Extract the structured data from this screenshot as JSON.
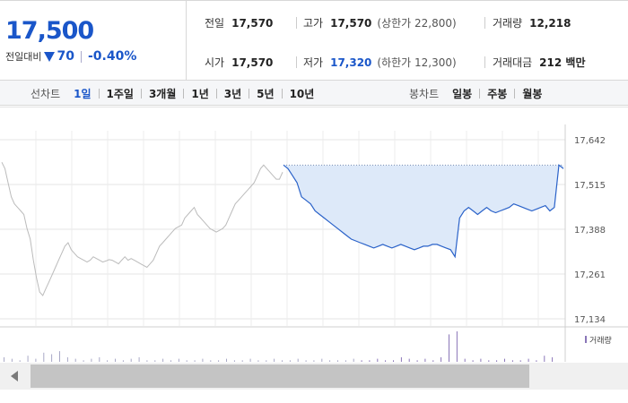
{
  "price": {
    "current": "17,500",
    "change_label": "전일대비",
    "change_amount": "70",
    "change_percent": "-0.40%",
    "direction_icon": "down-triangle-icon",
    "color": "#1a56c9"
  },
  "stats": {
    "prev_close_label": "전일",
    "prev_close": "17,570",
    "high_label": "고가",
    "high": "17,570",
    "upper_limit": "(상한가 22,800)",
    "volume_label": "거래량",
    "volume": "12,218",
    "open_label": "시가",
    "open": "17,570",
    "low_label": "저가",
    "low": "17,320",
    "lower_limit": "(하한가 12,300)",
    "amount_label": "거래대금",
    "amount": "212 백만"
  },
  "toolbar": {
    "line_chart_label": "선차트",
    "line_periods": [
      "1일",
      "1주일",
      "3개월",
      "1년",
      "3년",
      "5년",
      "10년"
    ],
    "active_line_period": "1일",
    "candle_chart_label": "봉차트",
    "candle_periods": [
      "일봉",
      "주봉",
      "월봉"
    ]
  },
  "chart_data": {
    "type": "line",
    "ylim": [
      17134,
      17642
    ],
    "y_ticks": [
      "17,642",
      "17,515",
      "17,388",
      "17,261",
      "17,134"
    ],
    "y_tick_values": [
      17642,
      17515,
      17388,
      17261,
      17134
    ],
    "reference_price": 17570,
    "series": [
      {
        "values": [
          17578,
          17560,
          17520,
          17480,
          17460,
          17450,
          17440,
          17430,
          17390,
          17360,
          17300,
          17250,
          17210,
          17200,
          17220,
          17240,
          17260,
          17280,
          17300,
          17320,
          17340,
          17350,
          17330,
          17320,
          17310,
          17305,
          17300,
          17295,
          17300,
          17310,
          17305,
          17300,
          17295,
          17298,
          17302,
          17300,
          17295,
          17290,
          17300,
          17310,
          17300,
          17305,
          17300,
          17295,
          17290,
          17285,
          17280,
          17290,
          17300,
          17320,
          17340,
          17350,
          17360,
          17370,
          17380,
          17390,
          17395,
          17400,
          17420,
          17430,
          17440,
          17450,
          17430,
          17420,
          17410,
          17400,
          17390,
          17385,
          17380,
          17385,
          17390,
          17400,
          17420,
          17440,
          17460,
          17470,
          17480,
          17490,
          17500,
          17510,
          17520,
          17540,
          17560,
          17570,
          17560,
          17550,
          17540,
          17530,
          17530,
          17550
        ],
        "color": "#bbbbbb"
      },
      {
        "values": [
          17570,
          17560,
          17540,
          17520,
          17480,
          17470,
          17460,
          17440,
          17430,
          17420,
          17410,
          17400,
          17390,
          17380,
          17370,
          17360,
          17355,
          17350,
          17345,
          17340,
          17335,
          17340,
          17345,
          17340,
          17335,
          17340,
          17345,
          17340,
          17335,
          17330,
          17335,
          17340,
          17340,
          17345,
          17345,
          17340,
          17335,
          17330,
          17310,
          17420,
          17440,
          17450,
          17440,
          17430,
          17440,
          17450,
          17440,
          17435,
          17440,
          17445,
          17450,
          17460,
          17455,
          17450,
          17445,
          17440,
          17445,
          17450,
          17455,
          17440,
          17450,
          17570,
          17560
        ],
        "color": "#2a62c9"
      }
    ],
    "volume_legend": "거래량",
    "volume_values": [
      3,
      2,
      1,
      4,
      2,
      6,
      5,
      7,
      3,
      2,
      1,
      2,
      3,
      1,
      2,
      1,
      2,
      3,
      1,
      1,
      2,
      1,
      2,
      1,
      1,
      2,
      1,
      1,
      2,
      1,
      1,
      2,
      1,
      1,
      2,
      1,
      1,
      2,
      1,
      1,
      2,
      1,
      1,
      1,
      2,
      1,
      1,
      2,
      1,
      1,
      3,
      2,
      1,
      2,
      1,
      3,
      18,
      20,
      2,
      1,
      2,
      1,
      1,
      2,
      1,
      1,
      2,
      1,
      4,
      3
    ]
  }
}
